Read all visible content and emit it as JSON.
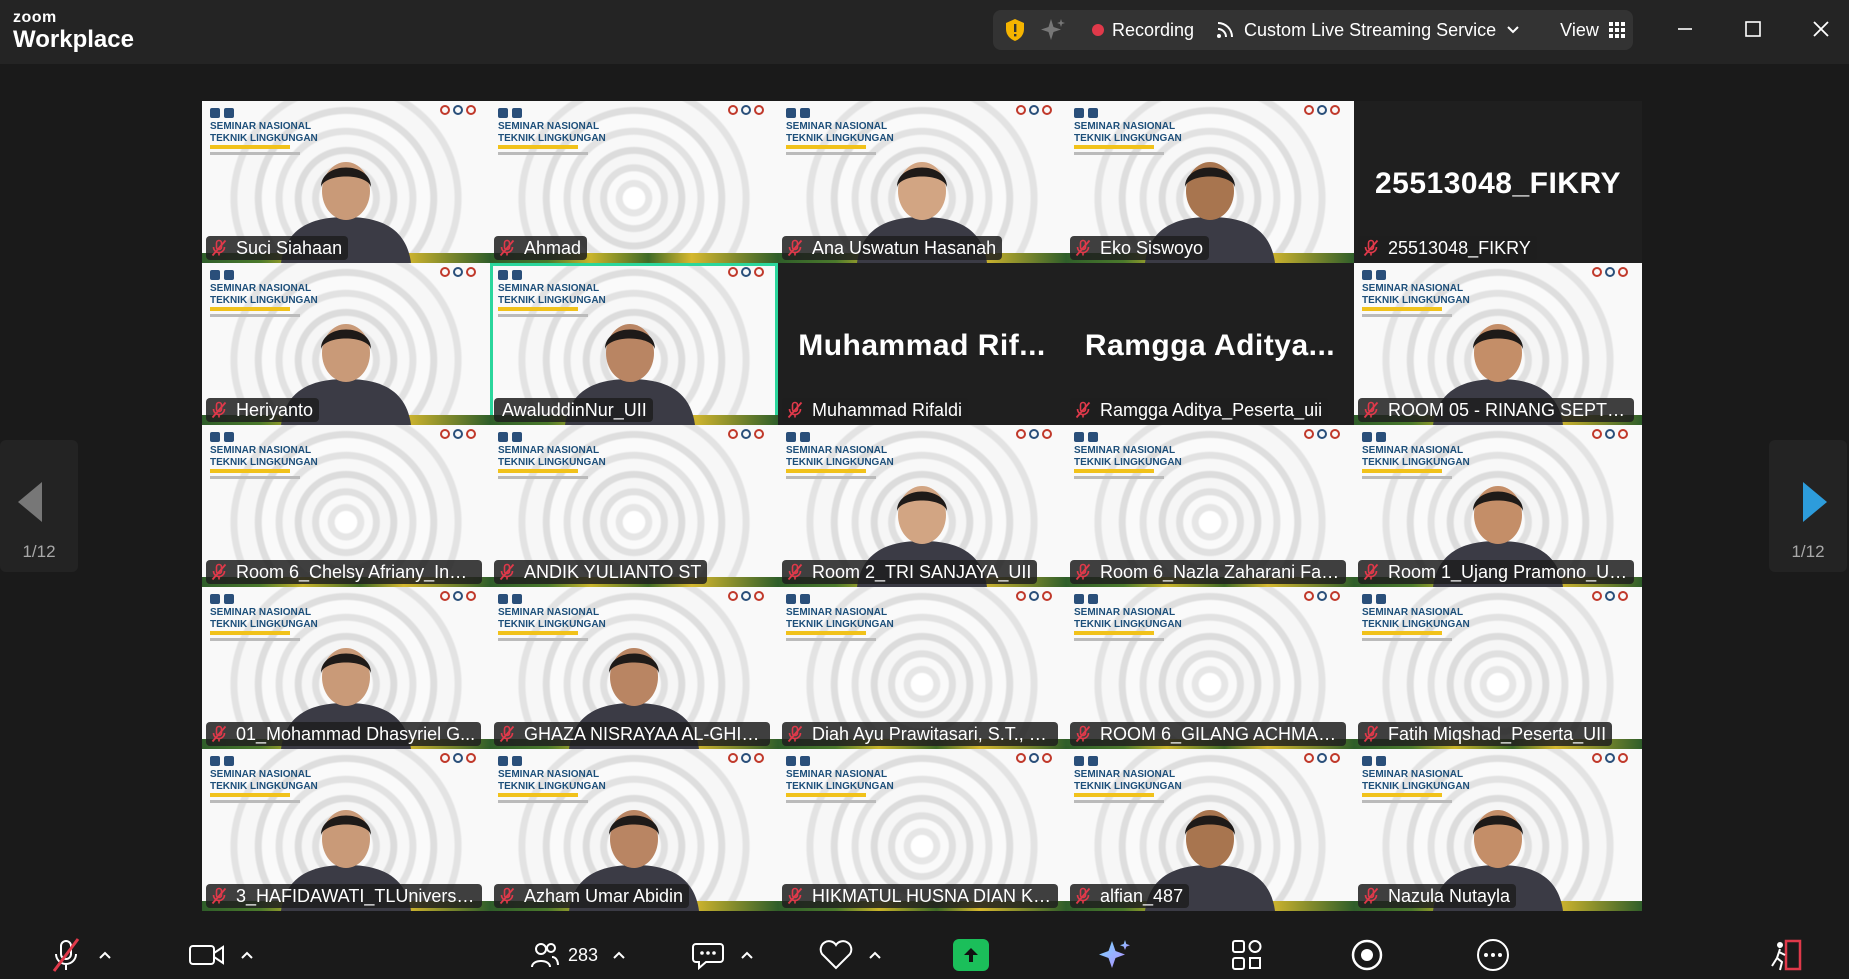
{
  "app": {
    "brand_top": "zoom",
    "brand_bottom": "Workplace"
  },
  "topbar": {
    "recording_label": "Recording",
    "streaming_label": "Custom Live Streaming Service",
    "view_label": "View",
    "colors": {
      "recording_dot": "#e0394a",
      "shield": "#f5b400"
    }
  },
  "banner": {
    "line1": "SEMINAR NASIONAL",
    "line2": "TEKNIK LINGKUNGAN"
  },
  "tiles": [
    {
      "name": "Suci Siahaan"
    },
    {
      "name": "Ahmad"
    },
    {
      "name": "Ana Uswatun Hasanah"
    },
    {
      "name": "Eko Siswoyo"
    },
    {
      "name": "25513048_FIKRY",
      "big": "25513048_FIKRY"
    },
    {
      "name": "Heriyanto"
    },
    {
      "name": "AwaluddinNur_UII"
    },
    {
      "name": "Muhammad Rifaldi",
      "big": "Muhammad  Rif..."
    },
    {
      "name": "Ramgga Aditya_Peserta_uii",
      "big": "Ramgga  Aditya..."
    },
    {
      "name": "ROOM 05 - RINANG SEPTIA..."
    },
    {
      "name": "Room 6_Chelsy Afriany_Insti..."
    },
    {
      "name": "ANDIK YULIANTO ST"
    },
    {
      "name": "Room 2_TRI SANJAYA_UII"
    },
    {
      "name": "Room 6_Nazla Zaharani Fati..."
    },
    {
      "name": "Room 1_Ujang Pramono_Un..."
    },
    {
      "name": "01_Mohammad Dhasyriel G..."
    },
    {
      "name": "GHAZA NISRAYAA AL-GHIFA..."
    },
    {
      "name": "Diah Ayu Prawitasari, S.T., M..."
    },
    {
      "name": "ROOM 6_GILANG ACHMAD ..."
    },
    {
      "name": "Fatih Miqshad_Peserta_UII"
    },
    {
      "name": "3_HAFIDAWATI_TLUniversita..."
    },
    {
      "name": "Azham Umar Abidin"
    },
    {
      "name": "HIKMATUL HUSNA DIAN KH..."
    },
    {
      "name": "alfian_487"
    },
    {
      "name": "Nazula Nutayla"
    }
  ],
  "pager": {
    "left_label": "1/12",
    "right_label": "1/12",
    "arrow_color": "#2d9cdb"
  },
  "toolbar": {
    "participants_count": "283",
    "share_color": "#1bbf5a"
  }
}
